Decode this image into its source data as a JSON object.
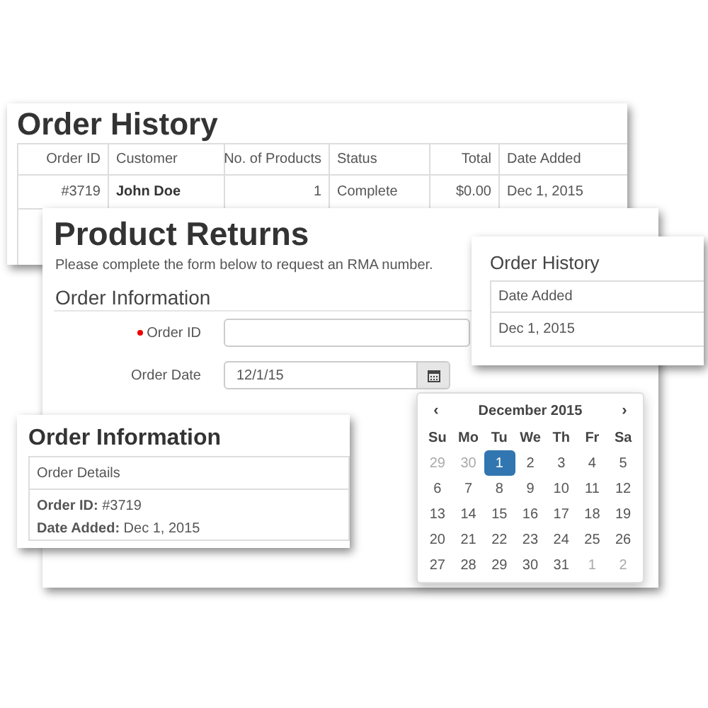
{
  "order_history_panel": {
    "title": "Order History",
    "columns": [
      "Order ID",
      "Customer",
      "No. of Products",
      "Status",
      "Total",
      "Date Added"
    ],
    "rows": [
      [
        "#3719",
        "John Doe",
        "1",
        "Complete",
        "$0.00",
        "Dec 1, 2015"
      ]
    ]
  },
  "product_returns_panel": {
    "title": "Product Returns",
    "description": "Please complete the form below to request an RMA number.",
    "section_title": "Order Information",
    "fields": [
      {
        "kind": "text",
        "label": "Order ID",
        "required": true
      },
      {
        "kind": "date",
        "label": "Order Date",
        "required": false,
        "value": "12/1/15"
      }
    ]
  },
  "order_history_card": {
    "title": "Order History",
    "columns": [
      "Date Added"
    ],
    "rows": [
      [
        "Dec 1, 2015"
      ]
    ]
  },
  "order_information_card": {
    "title": "Order Information",
    "panel_heading": "Order Details",
    "details": [
      {
        "label": "Order ID:",
        "value": "#3719"
      },
      {
        "label": "Date Added:",
        "value": "Dec 1, 2015"
      }
    ]
  },
  "datepicker": {
    "prev": "‹",
    "month_label": "December 2015",
    "next": "›",
    "weekdays": [
      "Su",
      "Mo",
      "Tu",
      "We",
      "Th",
      "Fr",
      "Sa"
    ],
    "weeks": [
      [
        {
          "day": "29",
          "muted": true,
          "selected": false
        },
        {
          "day": "30",
          "muted": true,
          "selected": false
        },
        {
          "day": "1",
          "muted": false,
          "selected": true
        },
        {
          "day": "2",
          "muted": false,
          "selected": false
        },
        {
          "day": "3",
          "muted": false,
          "selected": false
        },
        {
          "day": "4",
          "muted": false,
          "selected": false
        },
        {
          "day": "5",
          "muted": false,
          "selected": false
        }
      ],
      [
        {
          "day": "6",
          "muted": false,
          "selected": false
        },
        {
          "day": "7",
          "muted": false,
          "selected": false
        },
        {
          "day": "8",
          "muted": false,
          "selected": false
        },
        {
          "day": "9",
          "muted": false,
          "selected": false
        },
        {
          "day": "10",
          "muted": false,
          "selected": false
        },
        {
          "day": "11",
          "muted": false,
          "selected": false
        },
        {
          "day": "12",
          "muted": false,
          "selected": false
        }
      ],
      [
        {
          "day": "13",
          "muted": false,
          "selected": false
        },
        {
          "day": "14",
          "muted": false,
          "selected": false
        },
        {
          "day": "15",
          "muted": false,
          "selected": false
        },
        {
          "day": "16",
          "muted": false,
          "selected": false
        },
        {
          "day": "17",
          "muted": false,
          "selected": false
        },
        {
          "day": "18",
          "muted": false,
          "selected": false
        },
        {
          "day": "19",
          "muted": false,
          "selected": false
        }
      ],
      [
        {
          "day": "20",
          "muted": false,
          "selected": false
        },
        {
          "day": "21",
          "muted": false,
          "selected": false
        },
        {
          "day": "22",
          "muted": false,
          "selected": false
        },
        {
          "day": "23",
          "muted": false,
          "selected": false
        },
        {
          "day": "24",
          "muted": false,
          "selected": false
        },
        {
          "day": "25",
          "muted": false,
          "selected": false
        },
        {
          "day": "26",
          "muted": false,
          "selected": false
        }
      ],
      [
        {
          "day": "27",
          "muted": false,
          "selected": false
        },
        {
          "day": "28",
          "muted": false,
          "selected": false
        },
        {
          "day": "29",
          "muted": false,
          "selected": false
        },
        {
          "day": "30",
          "muted": false,
          "selected": false
        },
        {
          "day": "31",
          "muted": false,
          "selected": false
        },
        {
          "day": "1",
          "muted": true,
          "selected": false
        },
        {
          "day": "2",
          "muted": true,
          "selected": false
        }
      ]
    ]
  }
}
